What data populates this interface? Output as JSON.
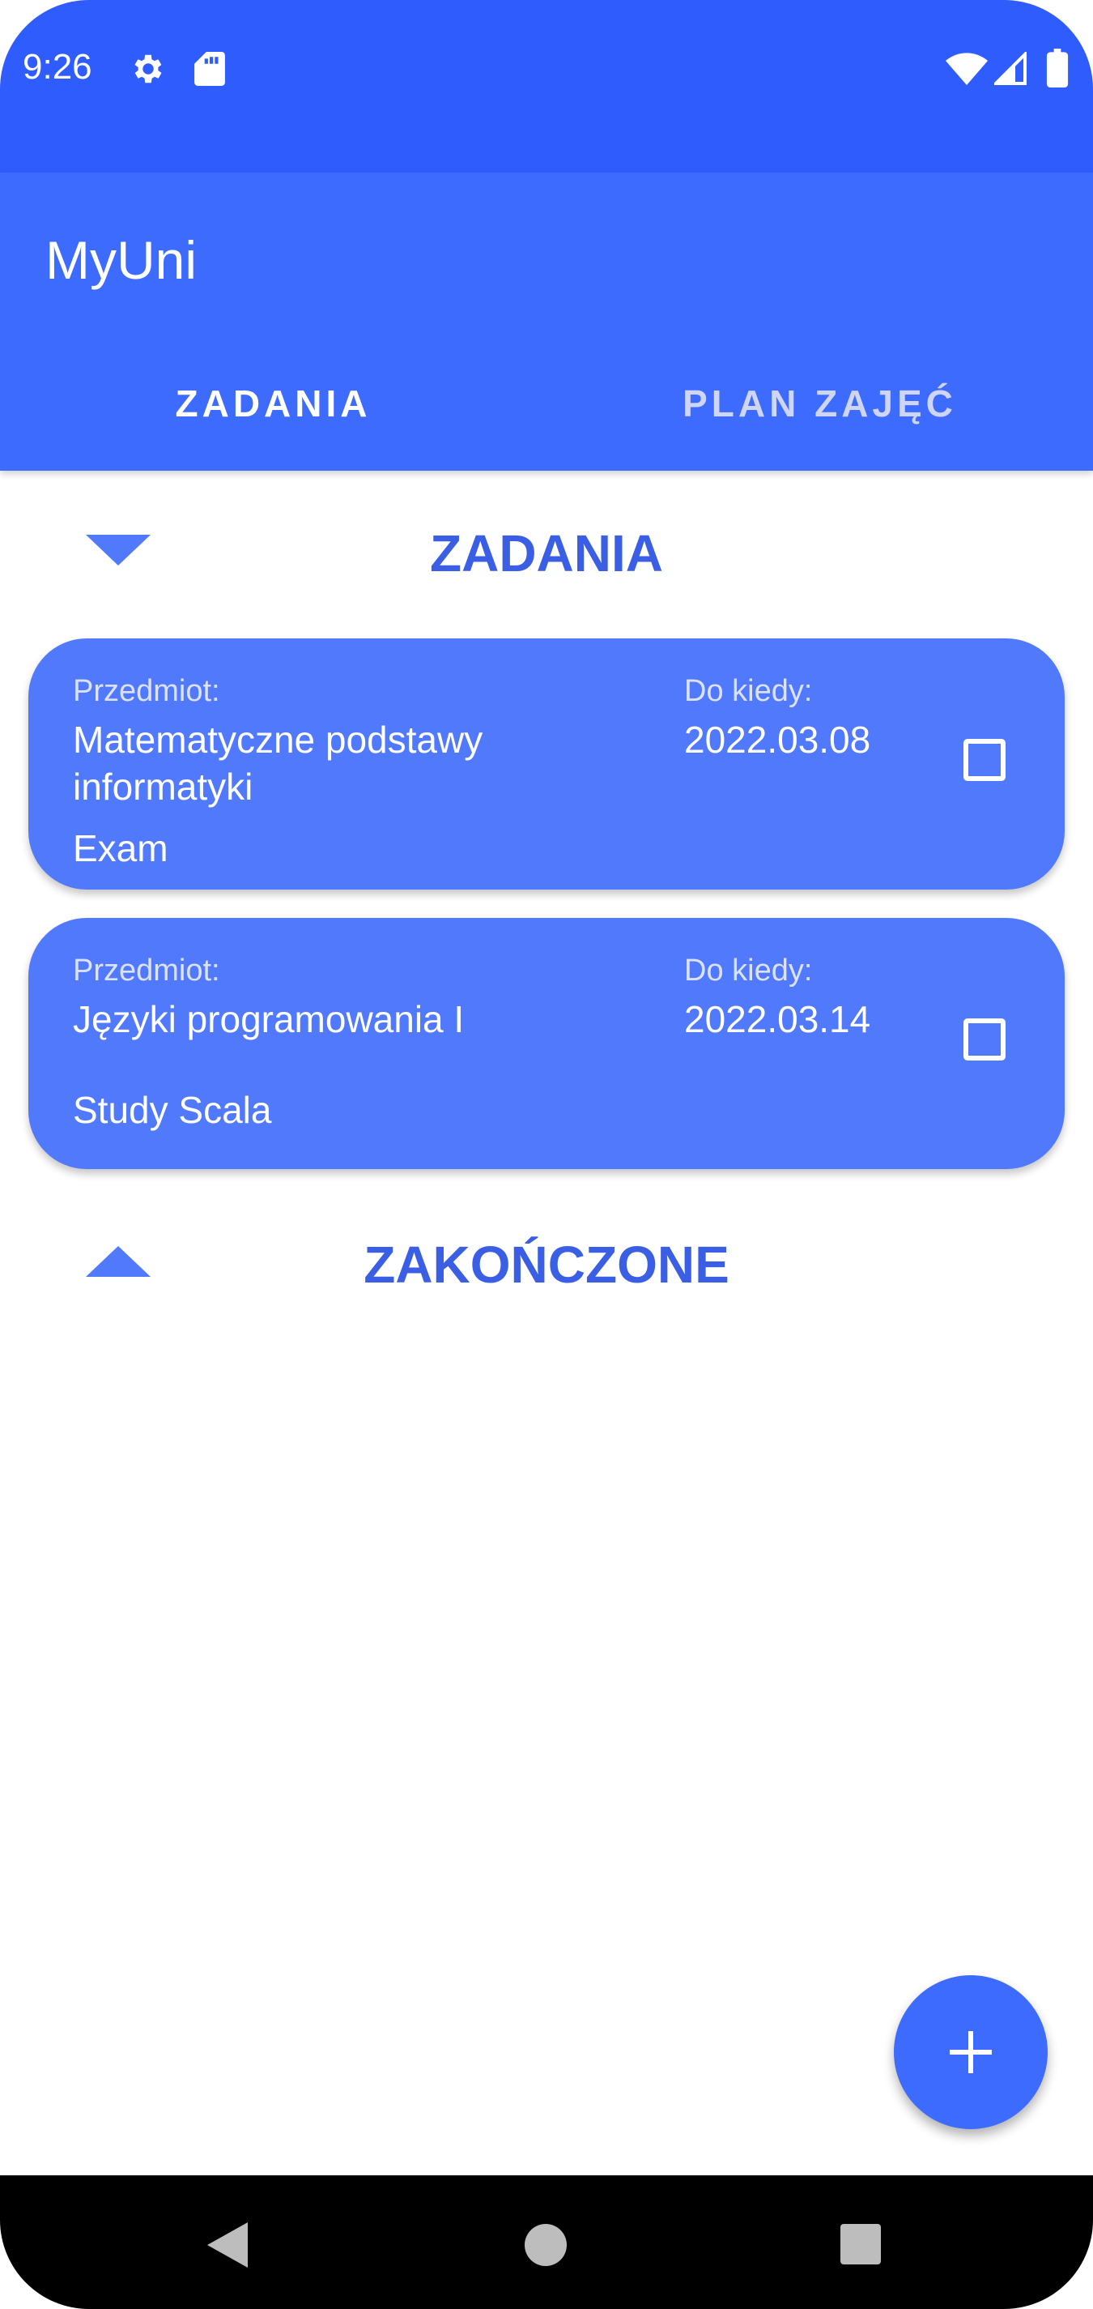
{
  "status_bar": {
    "time": "9:26",
    "icons": [
      "settings-icon",
      "sd-card-icon",
      "wifi-icon",
      "signal-icon",
      "battery-icon"
    ]
  },
  "app_bar": {
    "title": "MyUni",
    "tabs": [
      {
        "label": "ZADANIA",
        "active": true
      },
      {
        "label": "PLAN ZAJĘĆ",
        "active": false
      }
    ]
  },
  "sections": {
    "pending": {
      "title": "ZADANIA",
      "expanded": true
    },
    "done": {
      "title": "ZAKOŃCZONE",
      "expanded": false
    }
  },
  "tasks": [
    {
      "subject_label": "Przedmiot:",
      "subject": "Matematyczne podstawy informatyki",
      "due_label": "Do kiedy:",
      "due": "2022.03.08",
      "note": "Exam",
      "checked": false
    },
    {
      "subject_label": "Przedmiot:",
      "subject": "Języki programowania I",
      "due_label": "Do kiedy:",
      "due": "2022.03.14",
      "note": "Study Scala",
      "checked": false
    }
  ],
  "fab": {
    "icon": "plus-icon"
  },
  "nav_bar": {
    "icons": [
      "back-icon",
      "home-icon",
      "recents-icon"
    ]
  },
  "colors": {
    "status_bar": "#2f5dfd",
    "app_bar": "#3d6bfd",
    "card": "#5179fb",
    "section_title": "#3a5fe5",
    "tab_inactive": "#cfd5f4"
  }
}
